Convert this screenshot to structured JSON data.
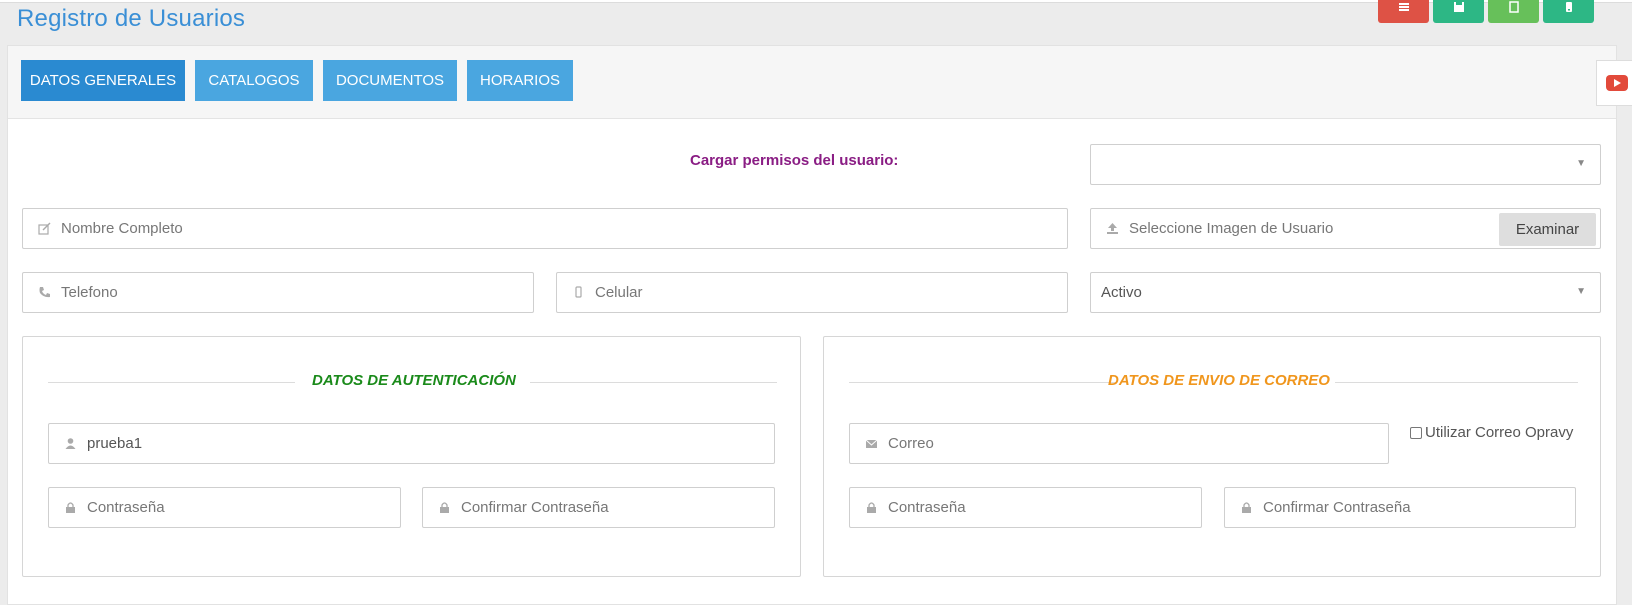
{
  "header": {
    "title": "Registro de Usuarios"
  },
  "toolbar": {
    "buttons": [
      {
        "icon": "list-icon",
        "color": "#de5245"
      },
      {
        "icon": "save-icon",
        "color": "#2db785"
      },
      {
        "icon": "new-document-icon",
        "color": "#67c05a"
      },
      {
        "icon": "mobile-icon",
        "color": "#2db785"
      }
    ]
  },
  "tabs": [
    {
      "label": "DATOS GENERALES",
      "active": true
    },
    {
      "label": "CATALOGOS",
      "active": false
    },
    {
      "label": "DOCUMENTOS",
      "active": false
    },
    {
      "label": "HORARIOS",
      "active": false
    }
  ],
  "form": {
    "permisos_label": "Cargar permisos del usuario:",
    "permisos_value": "",
    "nombre_placeholder": "Nombre Completo",
    "imagen_placeholder": "Seleccione Imagen de Usuario",
    "examinar_label": "Examinar",
    "telefono_placeholder": "Telefono",
    "celular_placeholder": "Celular",
    "estado_value": "Activo"
  },
  "autenticacion": {
    "title": "DATOS DE AUTENTICACIÓN",
    "title_color": "#1a8a1a",
    "usuario_value": "prueba1",
    "password_placeholder": "Contraseña",
    "confirm_placeholder": "Confirmar Contraseña"
  },
  "correo": {
    "title": "DATOS DE ENVIO DE CORREO",
    "title_color": "#f0961d",
    "correo_placeholder": "Correo",
    "utilizar_label": "Utilizar Correo Opravy",
    "utilizar_checked": false,
    "password_placeholder": "Contraseña",
    "confirm_placeholder": "Confirmar Contraseña"
  },
  "colors": {
    "tab_active": "#2a8ad1",
    "tab": "#4aa6e0",
    "title": "#3a8fd6",
    "permisos_label": "#8a1d84"
  }
}
